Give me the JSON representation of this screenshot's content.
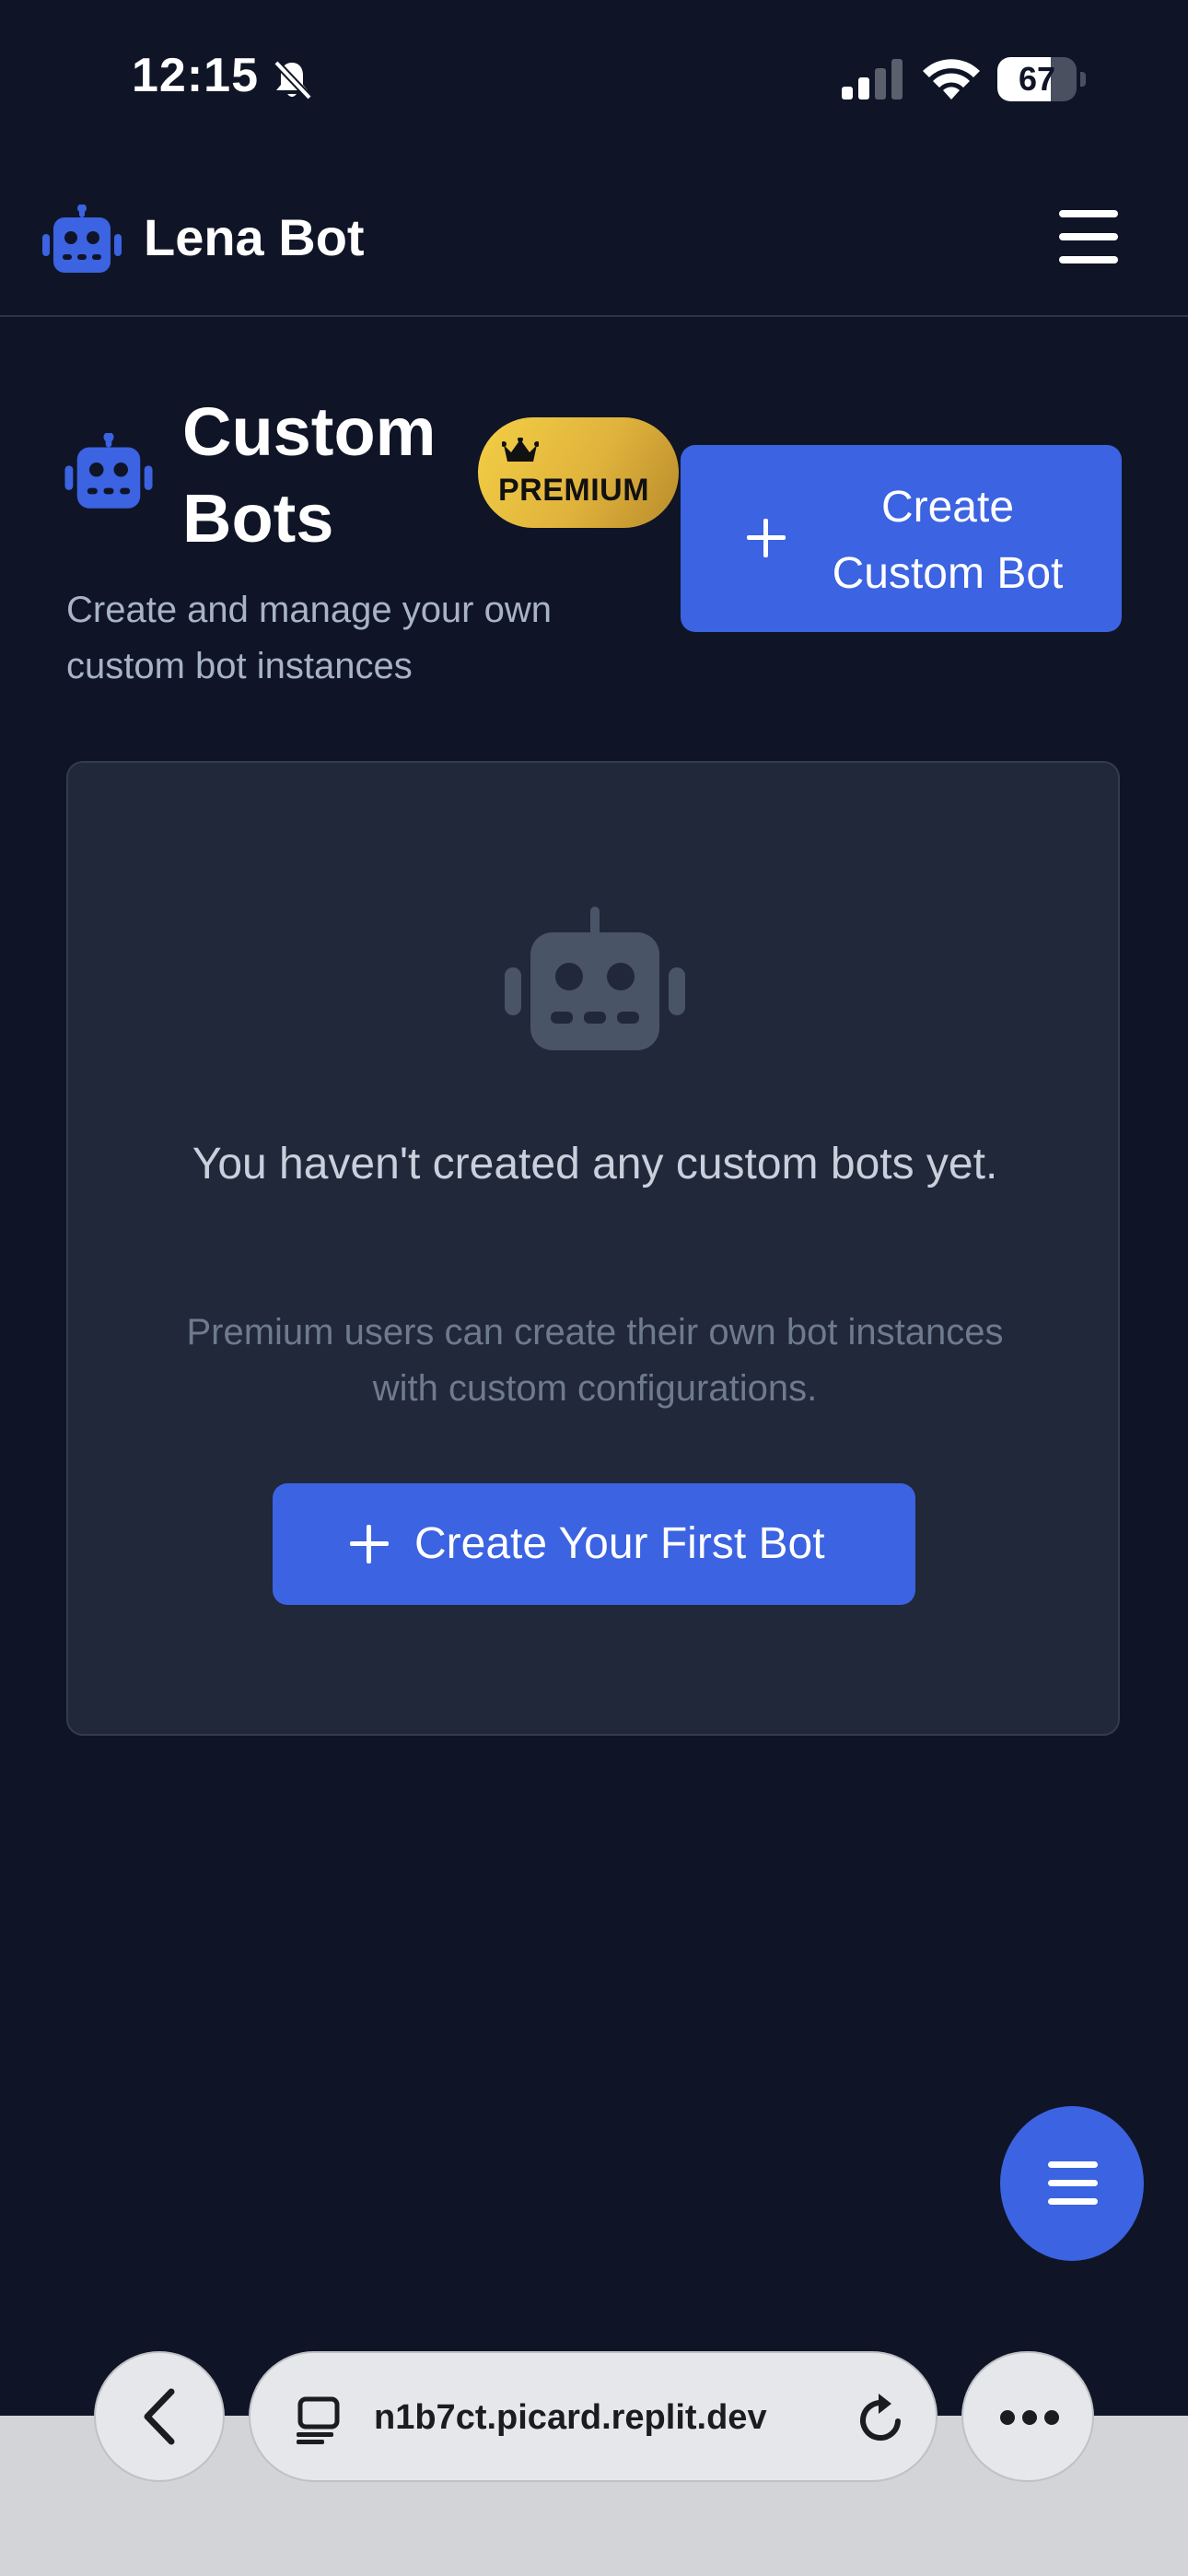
{
  "status_bar": {
    "time": "12:15",
    "battery_percent": "67",
    "battery_level": 0.67
  },
  "navbar": {
    "brand": "Lena Bot",
    "icons": [
      "robot-icon",
      "hamburger-menu-icon"
    ]
  },
  "header": {
    "title": "Custom Bots",
    "badge": "PREMIUM",
    "create_button_label": "Create Custom Bot",
    "subtitle": "Create and manage your own custom bot instances"
  },
  "empty_state": {
    "title": "You haven't created any custom bots yet.",
    "description": "Premium users can create their own bot instances with custom configurations.",
    "button_label": "Create Your First Bot"
  },
  "browser": {
    "url": "n1b7ct.picard.replit.dev"
  },
  "colors": {
    "background": "#0f1526",
    "card": "#202839",
    "accent": "#3b63e2",
    "premium_gold": "#e0b33c"
  }
}
